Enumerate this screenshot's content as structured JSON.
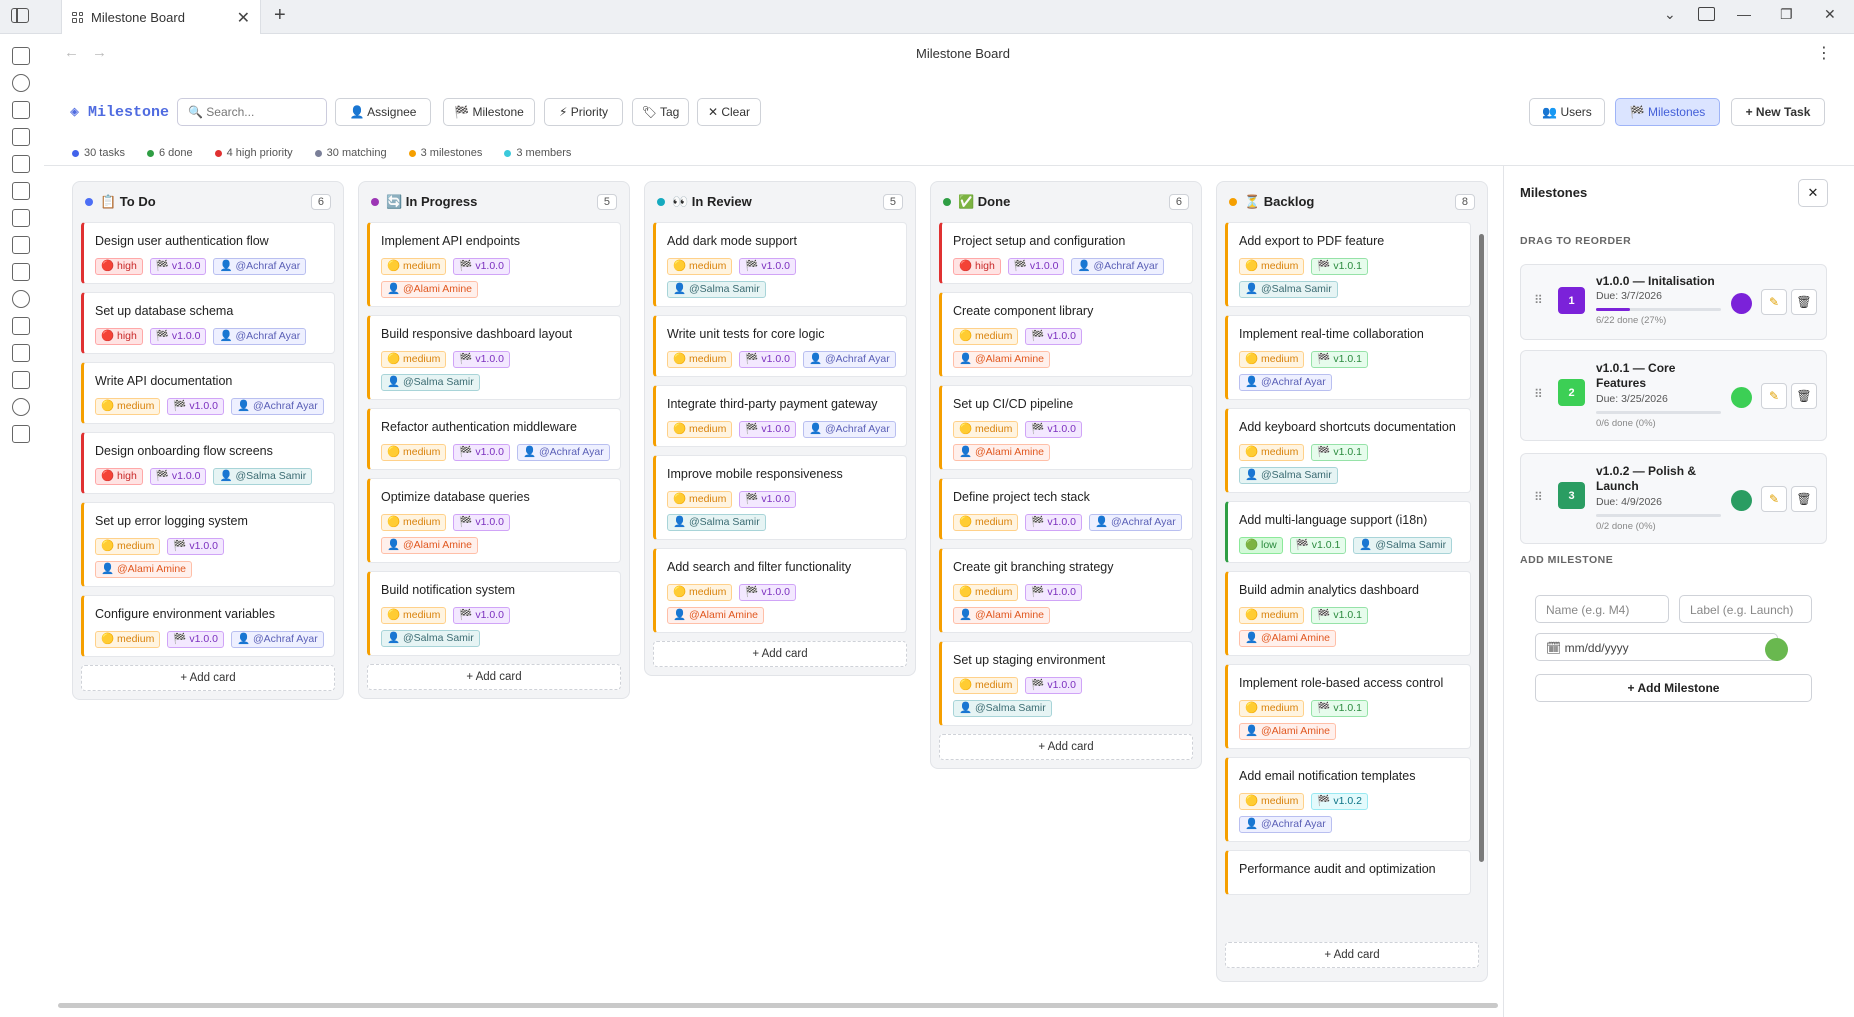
{
  "browser": {
    "tab_title": "Milestone Board",
    "page_title": "Milestone Board"
  },
  "toolbar": {
    "brand": "◈ Milestone",
    "search_placeholder": "🔍 Search...",
    "filters": [
      "👤 Assignee",
      "🏁 Milestone",
      "⚡ Priority",
      "🏷 Tag",
      "✕ Clear"
    ],
    "users_label": "👥 Users",
    "milestones_label": "🏁 Milestones",
    "new_task_label": "+ New Task"
  },
  "stats": [
    {
      "label": "30 tasks",
      "color": "#4263eb"
    },
    {
      "label": "6 done",
      "color": "#2f9e44"
    },
    {
      "label": "4 high priority",
      "color": "#e03131"
    },
    {
      "label": "30 matching",
      "color": "#7a7f98"
    },
    {
      "label": "3 milestones",
      "color": "#f59f00"
    },
    {
      "label": "3 members",
      "color": "#3bc9db"
    }
  ],
  "columns": [
    {
      "name": "📋 To Do",
      "count": "6",
      "dot": "#4c6ef5",
      "add_label": "+ Add card",
      "cards": [
        {
          "title": "Design user authentication flow",
          "priority": "high",
          "tags": [
            {
              "t": "🔴 high",
              "c": "pr-high"
            },
            {
              "t": "🏁 v1.0.0",
              "c": "ms-0"
            },
            {
              "t": "👤 @Achraf Ayar",
              "c": "as-a"
            }
          ]
        },
        {
          "title": "Set up database schema",
          "priority": "high",
          "tags": [
            {
              "t": "🔴 high",
              "c": "pr-high"
            },
            {
              "t": "🏁 v1.0.0",
              "c": "ms-0"
            },
            {
              "t": "👤 @Achraf Ayar",
              "c": "as-a"
            }
          ]
        },
        {
          "title": "Write API documentation",
          "priority": "medium",
          "tags": [
            {
              "t": "🟡 medium",
              "c": "pr-medium"
            },
            {
              "t": "🏁 v1.0.0",
              "c": "ms-0"
            },
            {
              "t": "👤 @Achraf Ayar",
              "c": "as-a"
            }
          ]
        },
        {
          "title": "Design onboarding flow screens",
          "priority": "high",
          "tags": [
            {
              "t": "🔴 high",
              "c": "pr-high"
            },
            {
              "t": "🏁 v1.0.0",
              "c": "ms-0"
            },
            {
              "t": "👤 @Salma Samir",
              "c": "as-s"
            }
          ]
        },
        {
          "title": "Set up error logging system",
          "priority": "medium",
          "tags": [
            {
              "t": "🟡 medium",
              "c": "pr-medium"
            },
            {
              "t": "🏁 v1.0.0",
              "c": "ms-0"
            },
            {
              "t": "👤 @Alami Amine",
              "c": "as-m"
            }
          ]
        },
        {
          "title": "Configure environment variables",
          "priority": "medium",
          "tags": [
            {
              "t": "🟡 medium",
              "c": "pr-medium"
            },
            {
              "t": "🏁 v1.0.0",
              "c": "ms-0"
            },
            {
              "t": "👤 @Achraf Ayar",
              "c": "as-a"
            }
          ]
        }
      ]
    },
    {
      "name": "🔄 In Progress",
      "count": "5",
      "dot": "#9c36b5",
      "add_label": "+ Add card",
      "cards": [
        {
          "title": "Implement API endpoints",
          "priority": "medium",
          "tags": [
            {
              "t": "🟡 medium",
              "c": "pr-medium"
            },
            {
              "t": "🏁 v1.0.0",
              "c": "ms-0"
            },
            {
              "t": "👤 @Alami Amine",
              "c": "as-m"
            }
          ]
        },
        {
          "title": "Build responsive dashboard layout",
          "priority": "medium",
          "tags": [
            {
              "t": "🟡 medium",
              "c": "pr-medium"
            },
            {
              "t": "🏁 v1.0.0",
              "c": "ms-0"
            },
            {
              "t": "👤 @Salma Samir",
              "c": "as-s"
            }
          ]
        },
        {
          "title": "Refactor authentication middleware",
          "priority": "medium",
          "tags": [
            {
              "t": "🟡 medium",
              "c": "pr-medium"
            },
            {
              "t": "🏁 v1.0.0",
              "c": "ms-0"
            },
            {
              "t": "👤 @Achraf Ayar",
              "c": "as-a"
            }
          ]
        },
        {
          "title": "Optimize database queries",
          "priority": "medium",
          "tags": [
            {
              "t": "🟡 medium",
              "c": "pr-medium"
            },
            {
              "t": "🏁 v1.0.0",
              "c": "ms-0"
            },
            {
              "t": "👤 @Alami Amine",
              "c": "as-m"
            }
          ]
        },
        {
          "title": "Build notification system",
          "priority": "medium",
          "tags": [
            {
              "t": "🟡 medium",
              "c": "pr-medium"
            },
            {
              "t": "🏁 v1.0.0",
              "c": "ms-0"
            },
            {
              "t": "👤 @Salma Samir",
              "c": "as-s"
            }
          ]
        }
      ]
    },
    {
      "name": "👀 In Review",
      "count": "5",
      "dot": "#15aabf",
      "add_label": "+ Add card",
      "cards": [
        {
          "title": "Add dark mode support",
          "priority": "medium",
          "tags": [
            {
              "t": "🟡 medium",
              "c": "pr-medium"
            },
            {
              "t": "🏁 v1.0.0",
              "c": "ms-0"
            },
            {
              "t": "👤 @Salma Samir",
              "c": "as-s"
            }
          ]
        },
        {
          "title": "Write unit tests for core logic",
          "priority": "medium",
          "tags": [
            {
              "t": "🟡 medium",
              "c": "pr-medium"
            },
            {
              "t": "🏁 v1.0.0",
              "c": "ms-0"
            },
            {
              "t": "👤 @Achraf Ayar",
              "c": "as-a"
            }
          ]
        },
        {
          "title": "Integrate third-party payment gateway",
          "priority": "medium",
          "tags": [
            {
              "t": "🟡 medium",
              "c": "pr-medium"
            },
            {
              "t": "🏁 v1.0.0",
              "c": "ms-0"
            },
            {
              "t": "👤 @Achraf Ayar",
              "c": "as-a"
            }
          ]
        },
        {
          "title": "Improve mobile responsiveness",
          "priority": "medium",
          "tags": [
            {
              "t": "🟡 medium",
              "c": "pr-medium"
            },
            {
              "t": "🏁 v1.0.0",
              "c": "ms-0"
            },
            {
              "t": "👤 @Salma Samir",
              "c": "as-s"
            }
          ]
        },
        {
          "title": "Add search and filter functionality",
          "priority": "medium",
          "tags": [
            {
              "t": "🟡 medium",
              "c": "pr-medium"
            },
            {
              "t": "🏁 v1.0.0",
              "c": "ms-0"
            },
            {
              "t": "👤 @Alami Amine",
              "c": "as-m"
            }
          ]
        }
      ]
    },
    {
      "name": "✅ Done",
      "count": "6",
      "dot": "#2f9e44",
      "add_label": "+ Add card",
      "cards": [
        {
          "title": "Project setup and configuration",
          "priority": "high",
          "tags": [
            {
              "t": "🔴 high",
              "c": "pr-high"
            },
            {
              "t": "🏁 v1.0.0",
              "c": "ms-0"
            },
            {
              "t": "👤 @Achraf Ayar",
              "c": "as-a"
            }
          ]
        },
        {
          "title": "Create component library",
          "priority": "medium",
          "tags": [
            {
              "t": "🟡 medium",
              "c": "pr-medium"
            },
            {
              "t": "🏁 v1.0.0",
              "c": "ms-0"
            },
            {
              "t": "👤 @Alami Amine",
              "c": "as-m"
            }
          ]
        },
        {
          "title": "Set up CI/CD pipeline",
          "priority": "medium",
          "tags": [
            {
              "t": "🟡 medium",
              "c": "pr-medium"
            },
            {
              "t": "🏁 v1.0.0",
              "c": "ms-0"
            },
            {
              "t": "👤 @Alami Amine",
              "c": "as-m"
            }
          ]
        },
        {
          "title": "Define project tech stack",
          "priority": "medium",
          "tags": [
            {
              "t": "🟡 medium",
              "c": "pr-medium"
            },
            {
              "t": "🏁 v1.0.0",
              "c": "ms-0"
            },
            {
              "t": "👤 @Achraf Ayar",
              "c": "as-a"
            }
          ]
        },
        {
          "title": "Create git branching strategy",
          "priority": "medium",
          "tags": [
            {
              "t": "🟡 medium",
              "c": "pr-medium"
            },
            {
              "t": "🏁 v1.0.0",
              "c": "ms-0"
            },
            {
              "t": "👤 @Alami Amine",
              "c": "as-m"
            }
          ]
        },
        {
          "title": "Set up staging environment",
          "priority": "medium",
          "tags": [
            {
              "t": "🟡 medium",
              "c": "pr-medium"
            },
            {
              "t": "🏁 v1.0.0",
              "c": "ms-0"
            },
            {
              "t": "👤 @Salma Samir",
              "c": "as-s"
            }
          ]
        }
      ]
    },
    {
      "name": "⏳ Backlog",
      "count": "8",
      "dot": "#f59f00",
      "add_label": "+ Add card",
      "cards": [
        {
          "title": "Add export to PDF feature",
          "priority": "medium",
          "tags": [
            {
              "t": "🟡 medium",
              "c": "pr-medium"
            },
            {
              "t": "🏁 v1.0.1",
              "c": "ms-1"
            },
            {
              "t": "👤 @Salma Samir",
              "c": "as-s"
            }
          ]
        },
        {
          "title": "Implement real-time collaboration",
          "priority": "medium",
          "tags": [
            {
              "t": "🟡 medium",
              "c": "pr-medium"
            },
            {
              "t": "🏁 v1.0.1",
              "c": "ms-1"
            },
            {
              "t": "👤 @Achraf Ayar",
              "c": "as-a"
            }
          ]
        },
        {
          "title": "Add keyboard shortcuts documentation",
          "priority": "medium",
          "tags": [
            {
              "t": "🟡 medium",
              "c": "pr-medium"
            },
            {
              "t": "🏁 v1.0.1",
              "c": "ms-1"
            },
            {
              "t": "👤 @Salma Samir",
              "c": "as-s"
            }
          ]
        },
        {
          "title": "Add multi-language support (i18n)",
          "priority": "low",
          "tags": [
            {
              "t": "🟢 low",
              "c": "pr-low"
            },
            {
              "t": "🏁 v1.0.1",
              "c": "ms-1"
            },
            {
              "t": "👤 @Salma Samir",
              "c": "as-s"
            }
          ]
        },
        {
          "title": "Build admin analytics dashboard",
          "priority": "medium",
          "tags": [
            {
              "t": "🟡 medium",
              "c": "pr-medium"
            },
            {
              "t": "🏁 v1.0.1",
              "c": "ms-1"
            },
            {
              "t": "👤 @Alami Amine",
              "c": "as-m"
            }
          ]
        },
        {
          "title": "Implement role-based access control",
          "priority": "medium",
          "tags": [
            {
              "t": "🟡 medium",
              "c": "pr-medium"
            },
            {
              "t": "🏁 v1.0.1",
              "c": "ms-1"
            },
            {
              "t": "👤 @Alami Amine",
              "c": "as-m"
            }
          ]
        },
        {
          "title": "Add email notification templates",
          "priority": "medium",
          "tags": [
            {
              "t": "🟡 medium",
              "c": "pr-medium"
            },
            {
              "t": "🏁 v1.0.2",
              "c": "ms-2"
            },
            {
              "t": "👤 @Achraf Ayar",
              "c": "as-a"
            }
          ]
        },
        {
          "title": "Performance audit and optimization",
          "priority": "medium",
          "tags": []
        }
      ]
    }
  ],
  "milestones_panel": {
    "title": "Milestones",
    "close_label": "✕",
    "reorder_label": "DRAG TO REORDER",
    "add_section_label": "ADD MILESTONE",
    "name_placeholder": "Name  (e.g. M4)",
    "label_placeholder": "Label  (e.g. Launch)",
    "date_placeholder": "mm/dd/yyyy",
    "add_button": "+ Add Milestone",
    "items": [
      {
        "num": "1",
        "name": "v1.0.0 — Initalisation",
        "due": "Due: 3/7/2026",
        "progress_text": "6/22 done (27%)",
        "progress": 0.27,
        "color": "#7b22d9"
      },
      {
        "num": "2",
        "name": "v1.0.1 — Core Features",
        "due": "Due: 3/25/2026",
        "progress_text": "0/6 done (0%)",
        "progress": 0,
        "color": "#3ccf55"
      },
      {
        "num": "3",
        "name": "v1.0.2 — Polish & Launch",
        "due": "Due: 4/9/2026",
        "progress_text": "0/2 done (0%)",
        "progress": 0,
        "color": "#2a9d62"
      }
    ]
  }
}
